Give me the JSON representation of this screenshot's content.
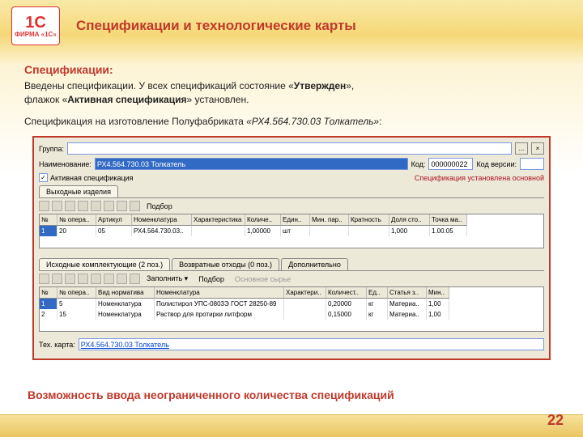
{
  "logo": {
    "big": "1С",
    "small": "ФИРМА «1С»"
  },
  "title": "Спецификации и технологические карты",
  "spec_header": "Спецификации:",
  "para1_a": "Введены спецификации. У всех спецификаций состояние «",
  "para1_b": "Утвержден",
  "para1_c": "»,",
  "para2_a": "флажок «",
  "para2_b": "Активная спецификация",
  "para2_c": "» установлен.",
  "para3_a": "Спецификация на изготовление Полуфабриката  ",
  "para3_b": "«РХ4.564.730.03 Толкатель»",
  "para3_c": ":",
  "win": {
    "group_lbl": "Группа:",
    "group_btn1": "...",
    "group_btn2": "×",
    "name_lbl": "Наименование:",
    "name_val": "РХ4.564.730.03 Толкатель",
    "code_lbl": "Код:",
    "code_val": "000000022",
    "ver_lbl": "Код версии:",
    "chk_active": "Активная спецификация",
    "status": "Спецификация установлена основной",
    "tab_out": "Выходные изделия",
    "tb_pick": "Подбор",
    "tbl1_headers": [
      "№",
      "№ опера..",
      "Артикул",
      "Номенклатура",
      "Характеристика",
      "Количе..",
      "Един..",
      "Мин. пар..",
      "Кратность",
      "Доля сто..",
      "Точка ма.."
    ],
    "tbl1_row": [
      "1",
      "20",
      "05",
      "РХ4.564.730.03..",
      "",
      "1,00000",
      "шт",
      "",
      "",
      "1,000",
      "1.00.05"
    ],
    "tabs2": [
      "Исходные комплектующие (2 поз.)",
      "Возвратные отходы (0 поз.)",
      "Дополнительно"
    ],
    "tb_fill": "Заполнить ▾",
    "tb_pick2": "Подбор",
    "tb_raw": "Основное сырье",
    "tbl2_headers": [
      "№",
      "№ опера..",
      "Вид норматива",
      "Номенклатура",
      "Характери..",
      "Количест..",
      "Ед..",
      "Статья з..",
      "Мин.."
    ],
    "tbl2_rows": [
      [
        "1",
        "5",
        "Номенклатура",
        "Полистирол УПС-0803Э ГОСТ 28250-89",
        "",
        "0,20000",
        "кг",
        "Материа..",
        "1,00"
      ],
      [
        "2",
        "15",
        "Номенклатура",
        "Раствор для протирки литформ",
        "",
        "0,15000",
        "кг",
        "Материа..",
        "1,00"
      ]
    ],
    "teh_lbl": "Тех. карта:",
    "teh_val": "РХ4.564.730.03 Толкатель"
  },
  "footer": "Возможность ввода неограниченного количества спецификаций",
  "page": "22"
}
